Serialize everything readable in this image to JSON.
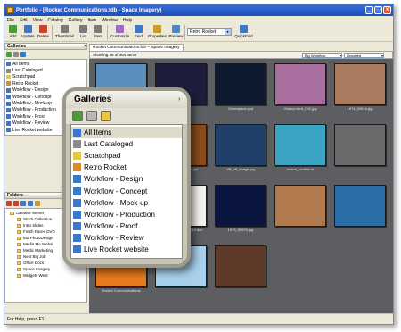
{
  "window": {
    "title": "Portfolio - [Rocket Communications.fdb - Space Imagery]",
    "min": "_",
    "max": "□",
    "close": "x"
  },
  "menu": [
    "File",
    "Edit",
    "View",
    "Catalog",
    "Gallery",
    "Item",
    "Window",
    "Help"
  ],
  "toolbar": {
    "buttons": [
      {
        "label": "Add",
        "icon": "add-icon",
        "color": "#4a9a3c"
      },
      {
        "label": "Update",
        "icon": "update-icon",
        "color": "#3b78c9"
      },
      {
        "label": "Delete",
        "icon": "delete-icon",
        "color": "#c9432c"
      },
      {
        "label": "Thumbnail",
        "icon": "thumbnail-view-icon",
        "color": "#7a7a7a"
      },
      {
        "label": "List",
        "icon": "list-view-icon",
        "color": "#7a7a7a"
      },
      {
        "label": "Item",
        "icon": "item-view-icon",
        "color": "#7a7a7a"
      },
      {
        "label": "Customize",
        "icon": "customize-icon",
        "color": "#9b6bc2"
      },
      {
        "label": "Find",
        "icon": "find-icon",
        "color": "#3b78c9"
      },
      {
        "label": "Properties",
        "icon": "properties-icon",
        "color": "#c99a2c"
      },
      {
        "label": "Preview",
        "icon": "preview-icon",
        "color": "#4a86c9"
      },
      {
        "label": "QuickFind",
        "icon": "quickfind-icon",
        "color": "#3b78c9"
      }
    ],
    "quickfind_value": "Retro Rocket"
  },
  "galleries_panel": {
    "title": "Galleries",
    "items": [
      {
        "label": "All Items",
        "icon": "all-items-icon",
        "color": "#3b78c9"
      },
      {
        "label": "Last Cataloged",
        "icon": "last-cataloged-icon",
        "color": "#8c8c8c"
      },
      {
        "label": "Scratchpad",
        "icon": "scratchpad-icon",
        "color": "#e8c64a"
      },
      {
        "label": "Retro Rocket",
        "icon": "gallery-icon",
        "color": "#d98b2a"
      },
      {
        "label": "Workflow - Design",
        "icon": "smart-gallery-icon",
        "color": "#3b78c9"
      },
      {
        "label": "Workflow - Concept",
        "icon": "smart-gallery-icon",
        "color": "#3b78c9"
      },
      {
        "label": "Workflow - Mock-up",
        "icon": "smart-gallery-icon",
        "color": "#3b78c9"
      },
      {
        "label": "Workflow - Production",
        "icon": "smart-gallery-icon",
        "color": "#3b78c9"
      },
      {
        "label": "Workflow - Proof",
        "icon": "smart-gallery-icon",
        "color": "#3b78c9"
      },
      {
        "label": "Workflow - Review",
        "icon": "smart-gallery-icon",
        "color": "#3b78c9"
      },
      {
        "label": "Live Rocket website",
        "icon": "smart-gallery-icon",
        "color": "#3b78c9"
      }
    ]
  },
  "folders_panel": {
    "title": "Folders",
    "items": [
      "Creative Server",
      "Stock Collection",
      "Intro Slides",
      "Fresh Faces DVD",
      "MZ PhotoDesign",
      "Media Mo Websi",
      "Medic Marketing",
      "Next Big Job",
      "Office Docs",
      "Space Imagery",
      "Widgets West"
    ]
  },
  "doc_tab": "Rocket Communications.fdb – Space Imagery",
  "infobar": {
    "showing": "Showing 48 of 464 items",
    "view_preset": "Big Workflow",
    "sort": "Unsorted"
  },
  "thumbnails": [
    {
      "caption": "",
      "color": "#5a8fbd"
    },
    {
      "caption": "",
      "color": "#1e1e3c"
    },
    {
      "caption": "Outerspace.psd",
      "color": "#0e1a2e"
    },
    {
      "caption": "Galaxy-bkrd_002.jpg",
      "color": "#a86f9e"
    },
    {
      "caption": "1974_0061b.jpg",
      "color": "#aa7a5e"
    },
    {
      "caption": "",
      "color": "#3d4a5c"
    },
    {
      "caption": "corp_presentation.ppt",
      "color": "#8a4a1c"
    },
    {
      "caption": "VB_off_image.jpg",
      "color": "#20406a"
    },
    {
      "caption": "rocket_contest.ai",
      "color": "#3aa4c2"
    },
    {
      "caption": "",
      "color": "#6a6a6a"
    },
    {
      "caption": "moonscape.tiff",
      "color": "#7a7a7a"
    },
    {
      "caption": "Rocket_proposal05010.doc",
      "color": "#f2f0ea"
    },
    {
      "caption": "1975_50976.jpg",
      "color": "#0a1640"
    },
    {
      "caption": "",
      "color": "#b07a4e"
    },
    {
      "caption": "",
      "color": "#2a6ea8"
    },
    {
      "caption": "Rocket Communications",
      "color": "#e67a1e"
    },
    {
      "caption": "",
      "color": "#a8d0ea"
    },
    {
      "caption": "",
      "color": "#5e3a2a"
    }
  ],
  "status": "For Help, press F1"
}
